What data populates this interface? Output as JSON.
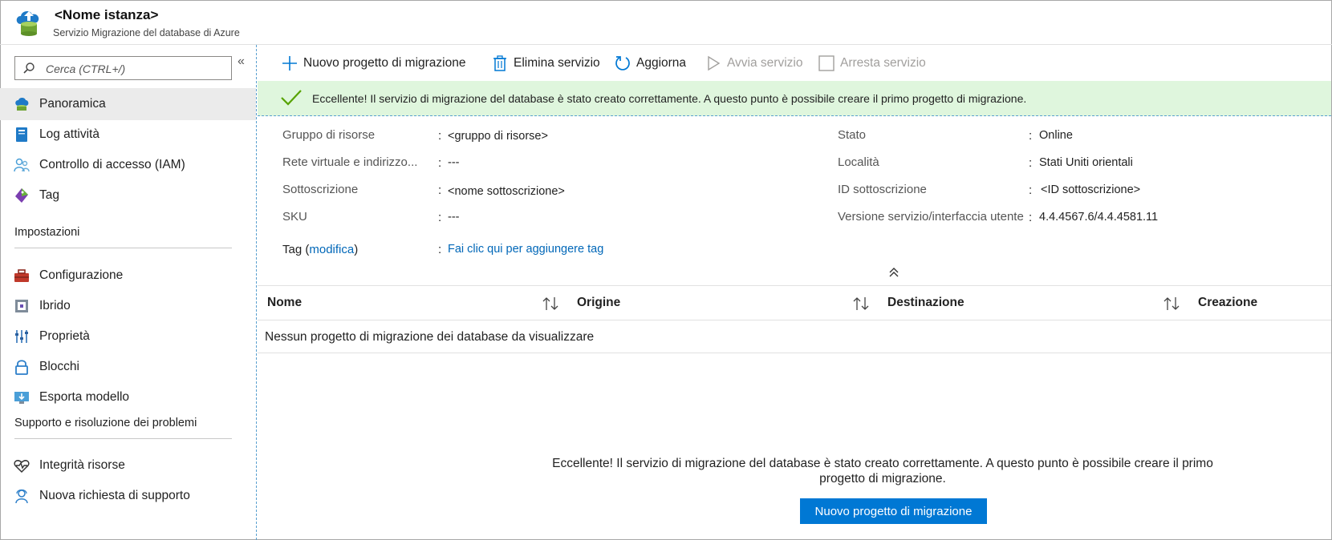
{
  "header": {
    "title": "<Nome istanza>",
    "subtitle": "Servizio Migrazione del database di Azure"
  },
  "sidebar": {
    "search_placeholder": "Cerca (CTRL+/)",
    "collapse_glyph": "«",
    "items": [
      {
        "label": "Panoramica",
        "icon": "overview-icon"
      },
      {
        "label": "Log attività",
        "icon": "activity-log-icon"
      },
      {
        "label": "Controllo di accesso (IAM)",
        "icon": "access-control-icon"
      },
      {
        "label": "Tag",
        "icon": "tag-icon"
      }
    ],
    "section_settings": "Impostazioni",
    "settings_items": [
      {
        "label": "Configurazione",
        "icon": "toolbox-icon"
      },
      {
        "label": "Ibrido",
        "icon": "hybrid-icon"
      },
      {
        "label": "Proprietà",
        "icon": "properties-icon"
      },
      {
        "label": "Blocchi",
        "icon": "lock-icon"
      },
      {
        "label": "Esporta modello",
        "icon": "export-template-icon"
      }
    ],
    "section_support": "Supporto e risoluzione dei problemi",
    "support_items": [
      {
        "label": "Integrità risorse",
        "icon": "heart-pulse-icon"
      },
      {
        "label": "Nuova richiesta di supporto",
        "icon": "support-person-icon"
      }
    ]
  },
  "toolbar": {
    "new_project": "Nuovo progetto di migrazione",
    "delete_service": "Elimina servizio",
    "refresh": "Aggiorna",
    "start_service": "Avvia servizio",
    "stop_service": "Arresta servizio"
  },
  "notification": {
    "message": "Eccellente! Il servizio di migrazione del database è stato creato correttamente. A questo punto è possibile creare il primo progetto di migrazione."
  },
  "essentials": {
    "left": [
      {
        "label": "Gruppo di risorse",
        "value": "<gruppo di risorse>"
      },
      {
        "label": "Rete virtuale e indirizzo...",
        "value": "---"
      },
      {
        "label": "Sottoscrizione",
        "value": "<nome sottoscrizione>"
      },
      {
        "label": "SKU",
        "value": "---"
      }
    ],
    "right": [
      {
        "label": "Stato",
        "value": "Online"
      },
      {
        "label": "Località",
        "value": "Stati Uniti orientali"
      },
      {
        "label": "ID sottoscrizione",
        "value": "<ID sottoscrizione>"
      },
      {
        "label": "Versione servizio/interfaccia utente",
        "value": "4.4.4567.6/4.4.4581.11"
      }
    ],
    "tags_label": "Tag",
    "tags_edit": "modifica",
    "tags_value": "Fai clic qui per aggiungere tag",
    "colon": ":"
  },
  "table": {
    "columns": [
      "Nome",
      "Origine",
      "Destinazione",
      "Creazione"
    ],
    "empty_text": "Nessun progetto di migrazione dei database da visualizzare"
  },
  "empty_state": {
    "message": "Eccellente! Il servizio di migrazione del database è stato creato correttamente. A questo punto è possibile creare il primo progetto di migrazione.",
    "button": "Nuovo progetto di migrazione"
  },
  "colors": {
    "accent": "#0078d4",
    "success_bg": "#dff6dd",
    "success_check": "#57a300",
    "link": "#0067b8"
  }
}
